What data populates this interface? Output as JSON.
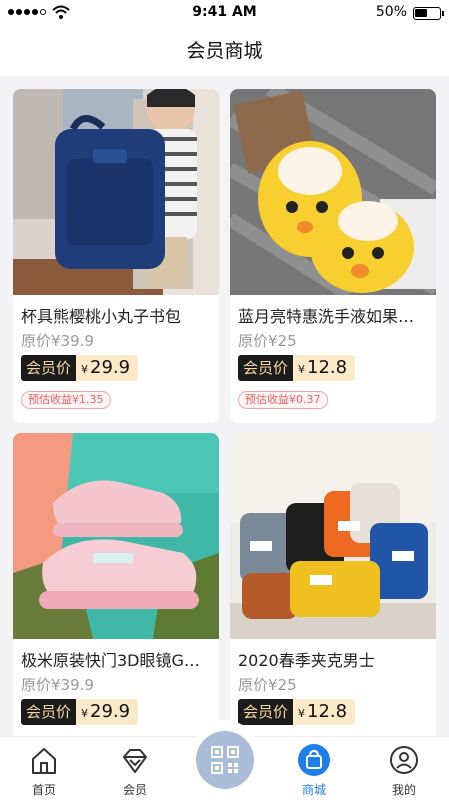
{
  "status_bar": {
    "time": "9:41 AM",
    "battery": "50%"
  },
  "header": {
    "title": "会员商城"
  },
  "products": [
    {
      "name": "杯具熊樱桃小丸子书包",
      "original_price": "原价¥39.9",
      "member_tag": "会员价",
      "currency": "¥",
      "member_price": "29.9",
      "earn": "预估收益¥1.35",
      "image_icon": "backpack-photo"
    },
    {
      "name": "蓝月亮特惠洗手液如果…",
      "original_price": "原价¥25",
      "member_tag": "会员价",
      "currency": "¥",
      "member_price": "12.8",
      "earn": "预估收益¥0.37",
      "image_icon": "slippers-photo"
    },
    {
      "name": "极米原装快门3D眼镜G…",
      "original_price": "原价¥39.9",
      "member_tag": "会员价",
      "currency": "¥",
      "member_price": "29.9",
      "image_icon": "sneakers-photo"
    },
    {
      "name": "2020春季夹克男士",
      "original_price": "原价¥25",
      "member_tag": "会员价",
      "currency": "¥",
      "member_price": "12.8",
      "image_icon": "beanies-photo"
    }
  ],
  "tabbar": {
    "items": [
      {
        "label": "首页",
        "icon": "home-icon"
      },
      {
        "label": "会员",
        "icon": "diamond-icon"
      },
      {
        "label": "商城",
        "icon": "shopping-bag-icon",
        "active": true
      },
      {
        "label": "我的",
        "icon": "user-icon"
      }
    ],
    "center_icon": "qr-scan-icon"
  },
  "colors": {
    "active": "#1f7fea",
    "member_tag_bg": "#1b1b1b",
    "member_price_bg": "#fce9c8",
    "earn": "#ec5f5f"
  }
}
